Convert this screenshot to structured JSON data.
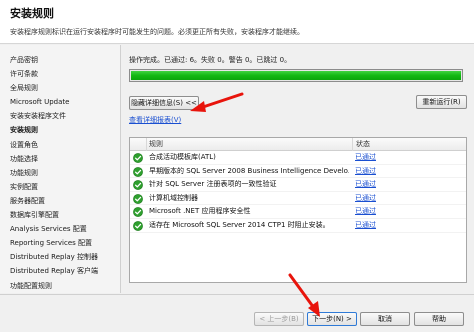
{
  "header": {
    "title": "安装规则",
    "description": "安装程序规则标识在运行安装程序时可能发生的问题。必须更正所有失败，安装程序才能继续。"
  },
  "sidebar": {
    "items": [
      {
        "label": "产品密钥"
      },
      {
        "label": "许可条款"
      },
      {
        "label": "全局规则"
      },
      {
        "label": "Microsoft Update"
      },
      {
        "label": "安装安装程序文件"
      },
      {
        "label": "安装规则"
      },
      {
        "label": "设置角色"
      },
      {
        "label": "功能选择"
      },
      {
        "label": "功能规则"
      },
      {
        "label": "实例配置"
      },
      {
        "label": "服务器配置"
      },
      {
        "label": "数据库引擎配置"
      },
      {
        "label": "Analysis Services 配置"
      },
      {
        "label": "Reporting Services 配置"
      },
      {
        "label": "Distributed Replay 控制器"
      },
      {
        "label": "Distributed Replay 客户端"
      },
      {
        "label": "功能配置规则"
      }
    ],
    "active_index": 5
  },
  "main": {
    "operation_status": "操作完成。已通过: 6。失败 0。警告 0。已跳过 0。",
    "progress": 1.0,
    "hide_details_label": "隐藏详细信息(S) <<",
    "rerun_label": "重新运行(R)",
    "view_report_link": "查看详细报表(V)",
    "table": {
      "columns": [
        "规则",
        "状态"
      ],
      "rows": [
        {
          "rule": "合成活动模板库(ATL)",
          "status": "已通过"
        },
        {
          "rule": "早期版本的 SQL Server 2008 Business Intelligence Develo...",
          "status": "已通过"
        },
        {
          "rule": "针对 SQL Server 注册表项的一致性验证",
          "status": "已通过"
        },
        {
          "rule": "计算机域控制器",
          "status": "已通过"
        },
        {
          "rule": "Microsoft .NET 应用程序安全性",
          "status": "已通过"
        },
        {
          "rule": "适存在 Microsoft SQL Server 2014 CTP1 时阻止安装。",
          "status": "已通过"
        }
      ]
    }
  },
  "footer": {
    "prev_label": "< 上一步(B)",
    "next_label": "下一步(N) >",
    "cancel_label": "取消",
    "help_label": "帮助"
  },
  "colors": {
    "progress_fill": "#12b812",
    "link": "#1a4fd1",
    "annotation_arrow": "#e8140c",
    "check_icon": "#2ea02e"
  },
  "icons": {
    "row_status_icon": "check-circle-icon"
  }
}
